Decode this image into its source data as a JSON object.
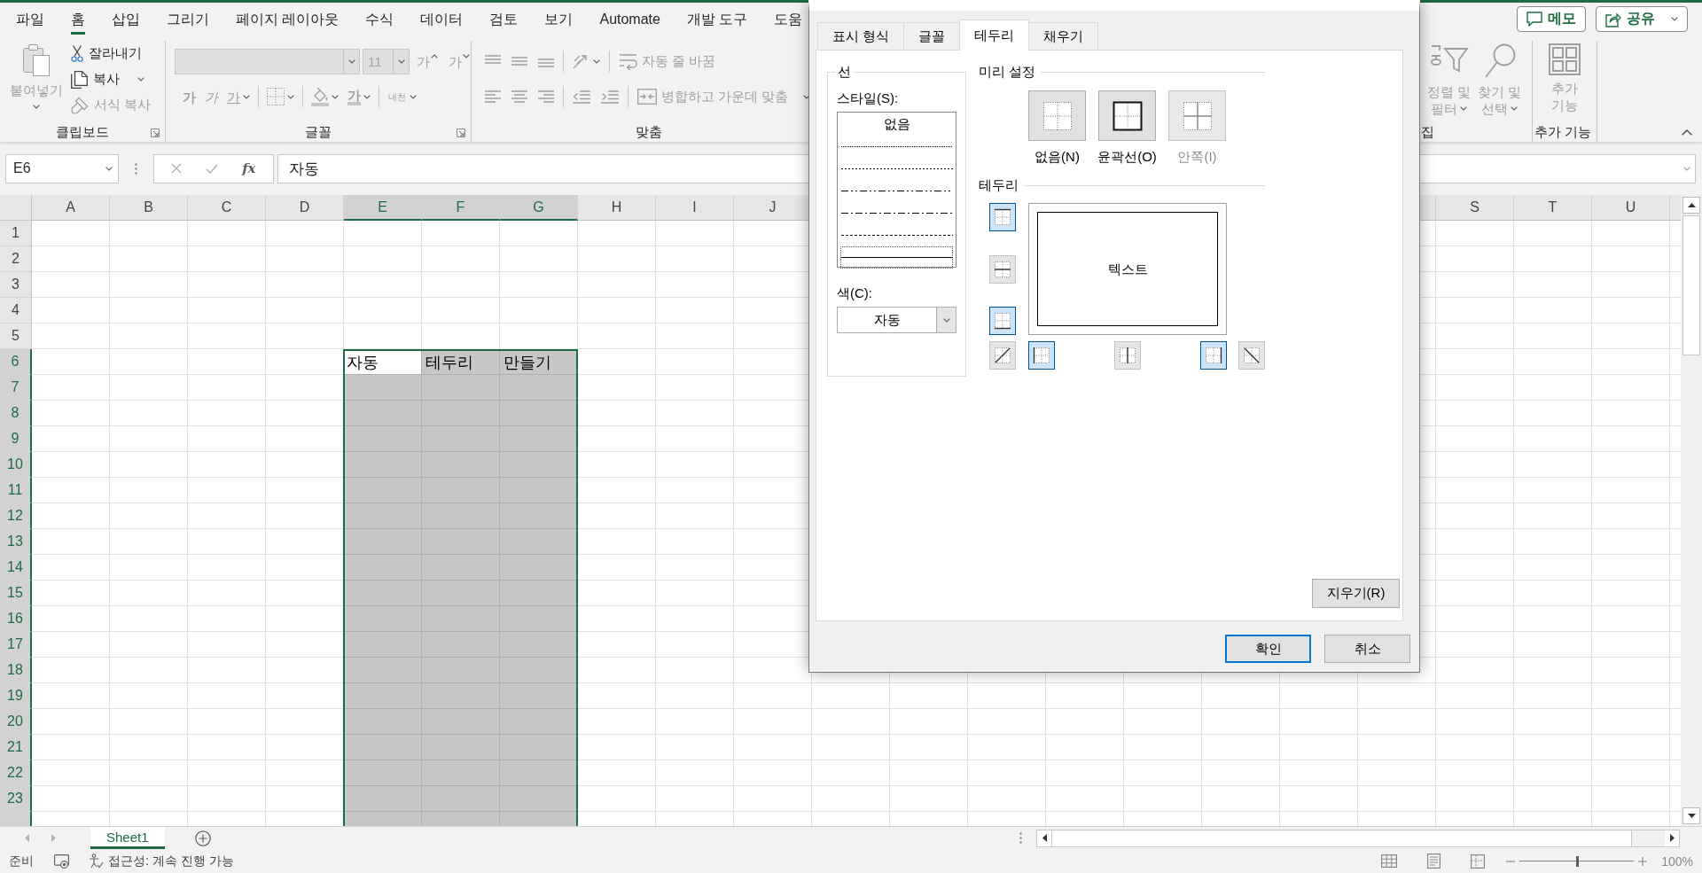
{
  "ribbon_tabs": [
    {
      "label": "파일",
      "selected": false
    },
    {
      "label": "홈",
      "selected": true
    },
    {
      "label": "삽입",
      "selected": false
    },
    {
      "label": "그리기",
      "selected": false
    },
    {
      "label": "페이지 레이아웃",
      "selected": false
    },
    {
      "label": "수식",
      "selected": false
    },
    {
      "label": "데이터",
      "selected": false
    },
    {
      "label": "검토",
      "selected": false
    },
    {
      "label": "보기",
      "selected": false
    },
    {
      "label": "Automate",
      "selected": false
    },
    {
      "label": "개발 도구",
      "selected": false
    },
    {
      "label": "도움",
      "selected": false
    }
  ],
  "top_buttons": [
    {
      "kind": "comments",
      "label": "메모"
    },
    {
      "kind": "share",
      "label": "공유",
      "menu": true
    }
  ],
  "ribbon_groups": [
    {
      "kind": "clipboard",
      "label": "클립보드",
      "launcher": true,
      "large": [
        {
          "kind": "paste",
          "lines": [
            "붙여넣기"
          ],
          "menu": true,
          "disabled": true
        }
      ],
      "rows": [
        {
          "controls": [
            {
              "kind": "cut",
              "label": "잘라내기",
              "disabled": false
            }
          ]
        },
        {
          "controls": [
            {
              "kind": "copy",
              "label": "복사",
              "menu": true,
              "disabled": false
            }
          ]
        },
        {
          "controls": [
            {
              "kind": "format_painter",
              "label": "서식 복사",
              "disabled": true
            }
          ]
        }
      ]
    },
    {
      "kind": "font",
      "label": "글꼴",
      "launcher": true,
      "rows": [
        {
          "controls": [
            {
              "kind": "font_name",
              "disabled": true
            },
            {
              "kind": "font_size",
              "value": "11",
              "disabled": true
            },
            {
              "kind": "grow_font",
              "glyph": "가",
              "disabled": true
            },
            {
              "kind": "shrink_font",
              "glyph": "가",
              "disabled": true
            }
          ]
        },
        {
          "controls": [
            {
              "kind": "bold",
              "glyph": "가",
              "disabled": true
            },
            {
              "kind": "italic",
              "glyph": "가",
              "disabled": true
            },
            {
              "kind": "underline",
              "glyph": "가",
              "menu": true,
              "disabled": true
            },
            {
              "kind": "separator"
            },
            {
              "kind": "borders",
              "menu": true,
              "disabled": true
            },
            {
              "kind": "separator"
            },
            {
              "kind": "fill_color",
              "menu": true,
              "disabled": true
            },
            {
              "kind": "font_color",
              "glyph": "가",
              "menu": true,
              "disabled": true
            },
            {
              "kind": "separator"
            },
            {
              "kind": "phonetic",
              "glyph": "내천",
              "menu": true,
              "disabled": true
            }
          ]
        }
      ]
    },
    {
      "kind": "alignment",
      "label": "맞춤",
      "rows": [
        {
          "controls": [
            {
              "kind": "align_top",
              "disabled": true
            },
            {
              "kind": "align_middle",
              "disabled": true
            },
            {
              "kind": "align_bottom",
              "disabled": true
            },
            {
              "kind": "separator"
            },
            {
              "kind": "orientation",
              "menu": true,
              "disabled": true
            },
            {
              "kind": "separator"
            },
            {
              "kind": "wrap_text",
              "label": "자동 줄 바꿈",
              "disabled": true
            }
          ]
        },
        {
          "controls": [
            {
              "kind": "align_left",
              "disabled": true
            },
            {
              "kind": "align_center",
              "disabled": true
            },
            {
              "kind": "align_right",
              "disabled": true
            },
            {
              "kind": "separator"
            },
            {
              "kind": "decrease_indent",
              "disabled": true
            },
            {
              "kind": "increase_indent",
              "disabled": true
            },
            {
              "kind": "separator"
            },
            {
              "kind": "merge_center",
              "label": "병합하고 가운데 맞춤",
              "menu": true,
              "disabled": true
            }
          ]
        }
      ]
    }
  ],
  "ribbon_groups_right": [
    {
      "kind": "editing",
      "label": "집",
      "large": [
        {
          "kind": "sort_filter",
          "lines": [
            "정렬 및",
            "필터"
          ],
          "menu": true,
          "disabled": true
        },
        {
          "kind": "find_select",
          "lines": [
            "찾기 및",
            "선택"
          ],
          "menu": true,
          "disabled": true
        }
      ]
    },
    {
      "kind": "add_ins",
      "label": "추가 기능",
      "large": [
        {
          "kind": "add_ins",
          "lines": [
            "추가",
            "기능"
          ],
          "disabled": true
        }
      ]
    }
  ],
  "formula_bar": {
    "name_box": "E6",
    "function_glyph": "fx",
    "value": "자동"
  },
  "sheet": {
    "columns": [
      {
        "label": "A",
        "selected": false
      },
      {
        "label": "B",
        "selected": false
      },
      {
        "label": "C",
        "selected": false
      },
      {
        "label": "D",
        "selected": false
      },
      {
        "label": "E",
        "selected": true
      },
      {
        "label": "F",
        "selected": true
      },
      {
        "label": "G",
        "selected": true
      },
      {
        "label": "H",
        "selected": false
      },
      {
        "label": "I",
        "selected": false
      },
      {
        "label": "J",
        "selected": false
      }
    ],
    "right_columns": [
      {
        "label": "S",
        "selected": false
      },
      {
        "label": "T",
        "selected": false
      },
      {
        "label": "U",
        "selected": false
      }
    ],
    "rows": [
      {
        "label": "1",
        "selected": false
      },
      {
        "label": "2",
        "selected": false
      },
      {
        "label": "3",
        "selected": false
      },
      {
        "label": "4",
        "selected": false
      },
      {
        "label": "5",
        "selected": false
      },
      {
        "label": "6",
        "selected": true,
        "cells": [
          {
            "text": "자동",
            "active": true
          },
          {
            "text": "테두리",
            "active": false
          },
          {
            "text": "만들기",
            "active": false
          }
        ]
      },
      {
        "label": "7",
        "selected": true
      },
      {
        "label": "8",
        "selected": true
      },
      {
        "label": "9",
        "selected": true
      },
      {
        "label": "10",
        "selected": true
      },
      {
        "label": "11",
        "selected": true
      },
      {
        "label": "12",
        "selected": true
      },
      {
        "label": "13",
        "selected": true
      },
      {
        "label": "14",
        "selected": true
      },
      {
        "label": "15",
        "selected": true
      },
      {
        "label": "16",
        "selected": true
      },
      {
        "label": "17",
        "selected": true
      },
      {
        "label": "18",
        "selected": true
      },
      {
        "label": "19",
        "selected": true
      },
      {
        "label": "20",
        "selected": true
      },
      {
        "label": "21",
        "selected": true
      },
      {
        "label": "22",
        "selected": true
      },
      {
        "label": "23",
        "selected": true
      }
    ]
  },
  "sheet_tabs": [
    {
      "label": "Sheet1",
      "selected": true
    }
  ],
  "status_bar": {
    "mode": "준비",
    "accessibility": "접근성: 계속 진행 가능",
    "views": [
      {
        "kind": "normal"
      },
      {
        "kind": "page_layout"
      },
      {
        "kind": "page_break"
      }
    ],
    "zoom": {
      "level": 0.5,
      "reading": "100%"
    }
  },
  "dialog": {
    "tabs": [
      {
        "label": "표시 형식",
        "selected": false
      },
      {
        "label": "글꼴",
        "selected": false
      },
      {
        "label": "테두리",
        "selected": true
      },
      {
        "label": "채우기",
        "selected": false
      }
    ],
    "line": {
      "title": "선",
      "style_label": "스타일(S):",
      "styles": [
        {
          "kind": "none",
          "text": "없음",
          "selected": false
        },
        {
          "kind": "hair",
          "selected": false
        },
        {
          "kind": "dotted",
          "selected": false
        },
        {
          "kind": "dash_dot_dot",
          "selected": false
        },
        {
          "kind": "dash_dot",
          "selected": false
        },
        {
          "kind": "dashed",
          "selected": false
        },
        {
          "kind": "thin",
          "selected": true
        }
      ],
      "color_label": "색(C):",
      "color_setting": "자동"
    },
    "presets": {
      "title": "미리 설정",
      "items": [
        {
          "kind": "none",
          "label": "없음(N)",
          "disabled": false
        },
        {
          "kind": "outline",
          "label": "윤곽선(O)",
          "disabled": false
        },
        {
          "kind": "inside",
          "label": "안쪽(I)",
          "disabled": true
        }
      ]
    },
    "border": {
      "title": "테두리",
      "preview_text": "텍스트",
      "buttons": [
        {
          "kind": "top",
          "selected": true
        },
        {
          "kind": "inside_horizontal",
          "selected": false
        },
        {
          "kind": "bottom",
          "selected": true
        },
        {
          "kind": "diagonal_up",
          "selected": false
        },
        {
          "kind": "left",
          "selected": true
        },
        {
          "kind": "inside_vertical",
          "selected": false
        },
        {
          "kind": "right",
          "selected": true
        },
        {
          "kind": "diagonal_down",
          "selected": false
        }
      ]
    },
    "clear_button": "지우기(R)",
    "buttons": [
      {
        "label": "확인",
        "default": true
      },
      {
        "label": "취소",
        "default": false
      }
    ]
  }
}
